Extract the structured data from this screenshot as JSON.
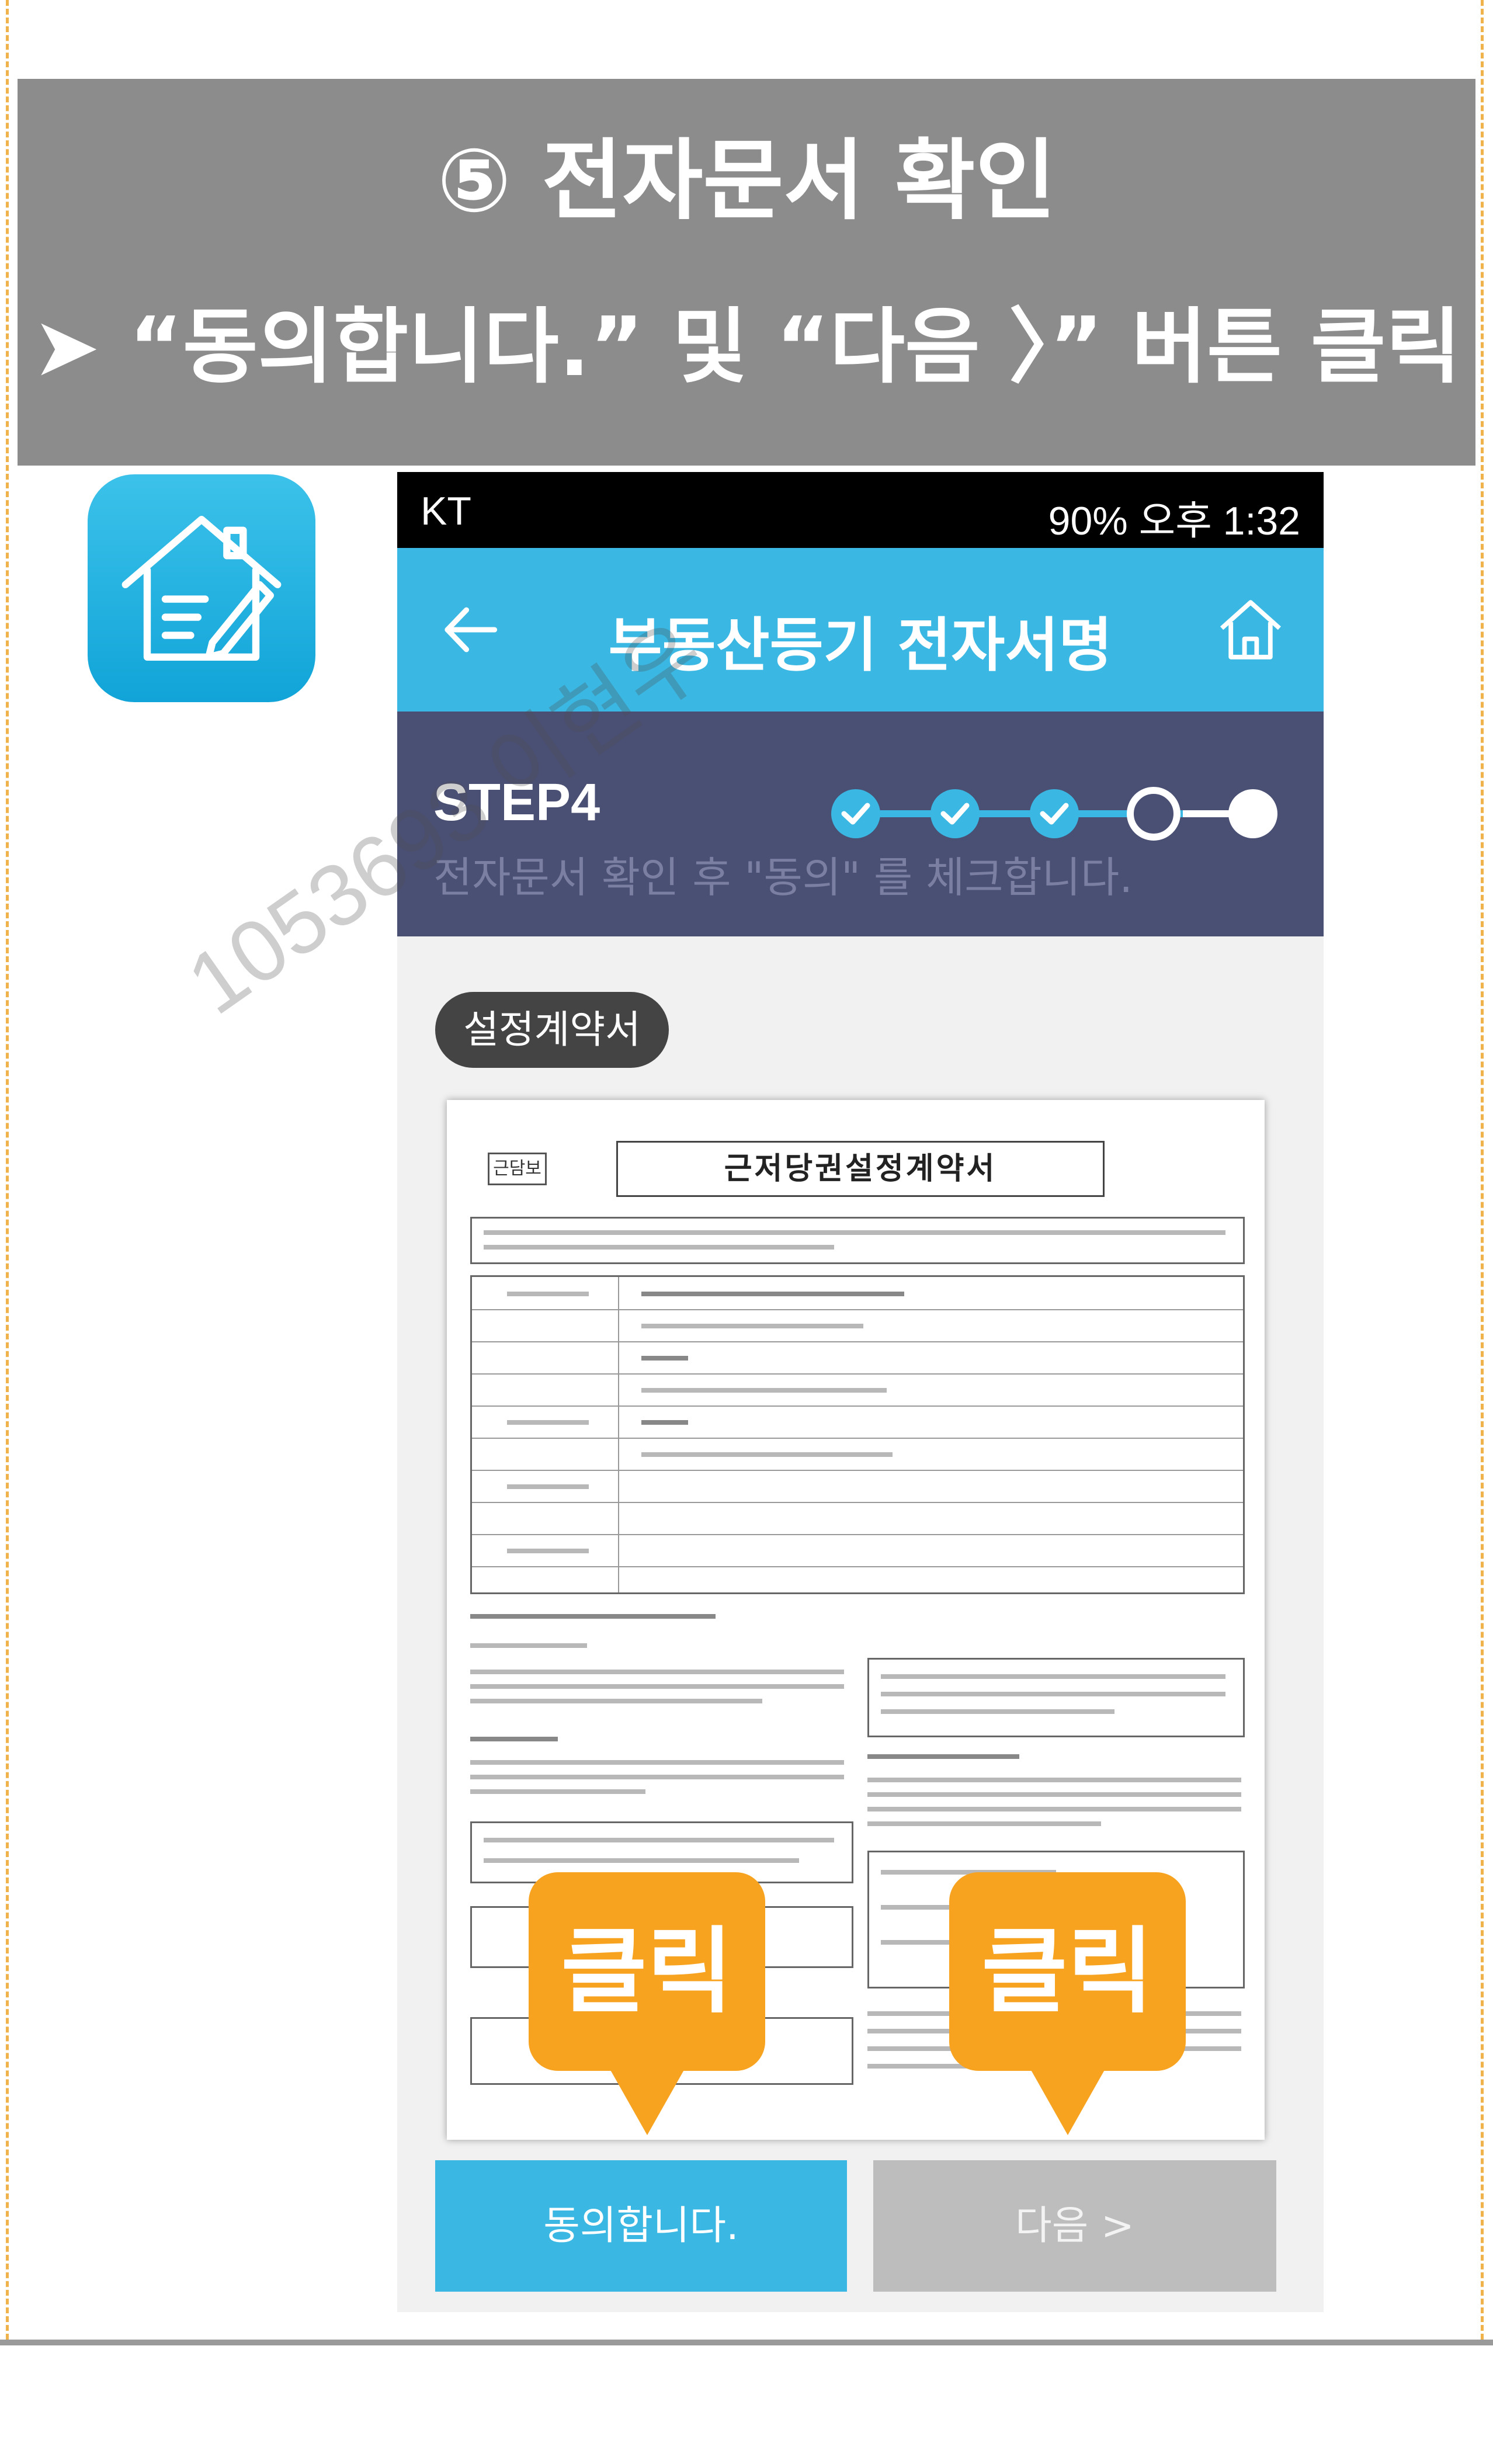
{
  "banner": {
    "title": "⑤ 전자문서 확인",
    "subtitle": "➤ “동의합니다.” 및 “다음 〉” 버튼 클릭"
  },
  "app_icon": "house-document-pen-icon",
  "status_bar": {
    "carrier": "KT",
    "right_text": "90% 오후 1:32"
  },
  "app_bar": {
    "title": "부동산등기 전자서명",
    "back_icon": "back-arrow-icon",
    "home_icon": "home-icon"
  },
  "step": {
    "label": "STEP4",
    "description": "전자문서 확인 후 \"동의\" 를 체크합니다.",
    "completed_steps": 3,
    "current_step": 4,
    "total_steps": 5
  },
  "document_tag": "설정계약서",
  "document": {
    "label": "근담보",
    "title": "근저당권설정계약서"
  },
  "watermark": "1053693 이현우",
  "buttons": {
    "agree": "동의합니다.",
    "next": "다음 >"
  },
  "callouts": {
    "agree": "클릭",
    "next": "클릭"
  },
  "colors": {
    "accent": "#3ab8e3",
    "step_bar": "#4a4f74",
    "callout": "#f8a31f",
    "banner": "#8c8c8c"
  }
}
